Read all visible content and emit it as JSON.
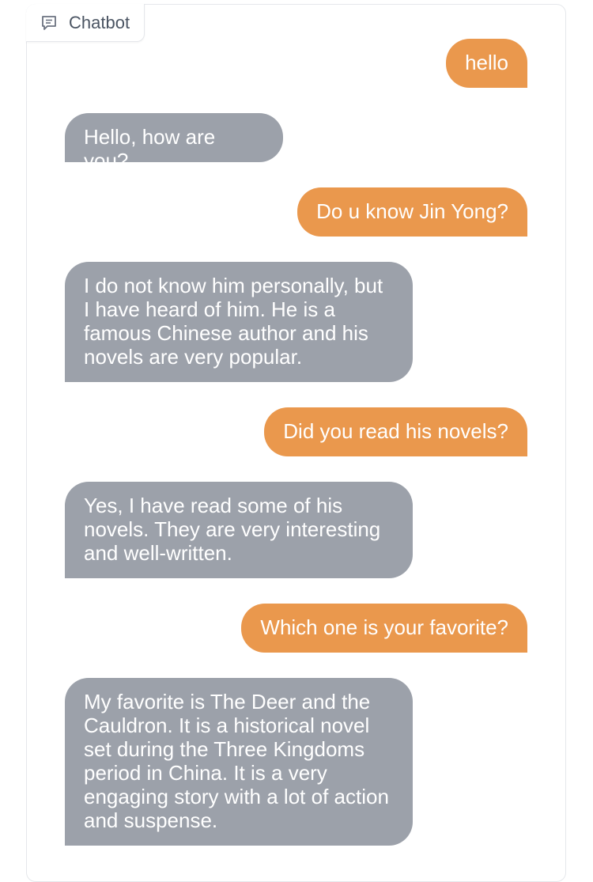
{
  "chatbot": {
    "label": "Chatbot",
    "icon": "chat-icon",
    "colors": {
      "user_bubble": "#ea984d",
      "bot_bubble": "#9ca1aa",
      "text": "#ffffff"
    },
    "messages": [
      {
        "role": "user",
        "text": "hello"
      },
      {
        "role": "bot",
        "text": "Hello, how are you?"
      },
      {
        "role": "user",
        "text": "Do u know Jin Yong?"
      },
      {
        "role": "bot",
        "text": "I do not know him personally, but I have heard of him. He is a famous Chinese author and his novels are very popular."
      },
      {
        "role": "user",
        "text": "Did you read his novels?"
      },
      {
        "role": "bot",
        "text": "Yes, I have read some of his novels. They are very interesting and well-written."
      },
      {
        "role": "user",
        "text": "Which one is your favorite?"
      },
      {
        "role": "bot",
        "text": "My favorite is The Deer and the Cauldron. It is a historical novel set during the Three Kingdoms period in China. It is a very engaging story with a lot of action and suspense."
      }
    ]
  }
}
